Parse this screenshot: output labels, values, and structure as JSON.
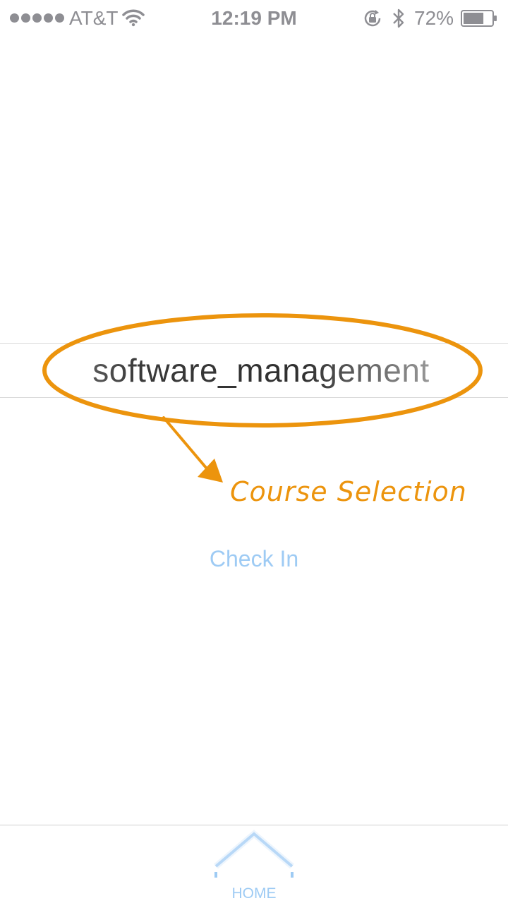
{
  "status_bar": {
    "carrier": "AT&T",
    "time": "12:19 PM",
    "battery_percent": "72%",
    "battery_level": 0.72,
    "signal_dots": 5,
    "icons": [
      "signal-icon",
      "wifi-icon",
      "orientation-lock-icon",
      "bluetooth-icon",
      "battery-icon"
    ]
  },
  "course_picker": {
    "value": "software_management"
  },
  "annotation": {
    "label": "Course Selection",
    "color": "#ec940d"
  },
  "actions": {
    "check_in_label": "Check In"
  },
  "tab_bar": {
    "items": [
      {
        "label": "HOME",
        "icon": "home-icon"
      }
    ]
  },
  "colors": {
    "accent": "#9ecbf4",
    "status_text": "#8e8e93",
    "annotation": "#ec940d"
  }
}
